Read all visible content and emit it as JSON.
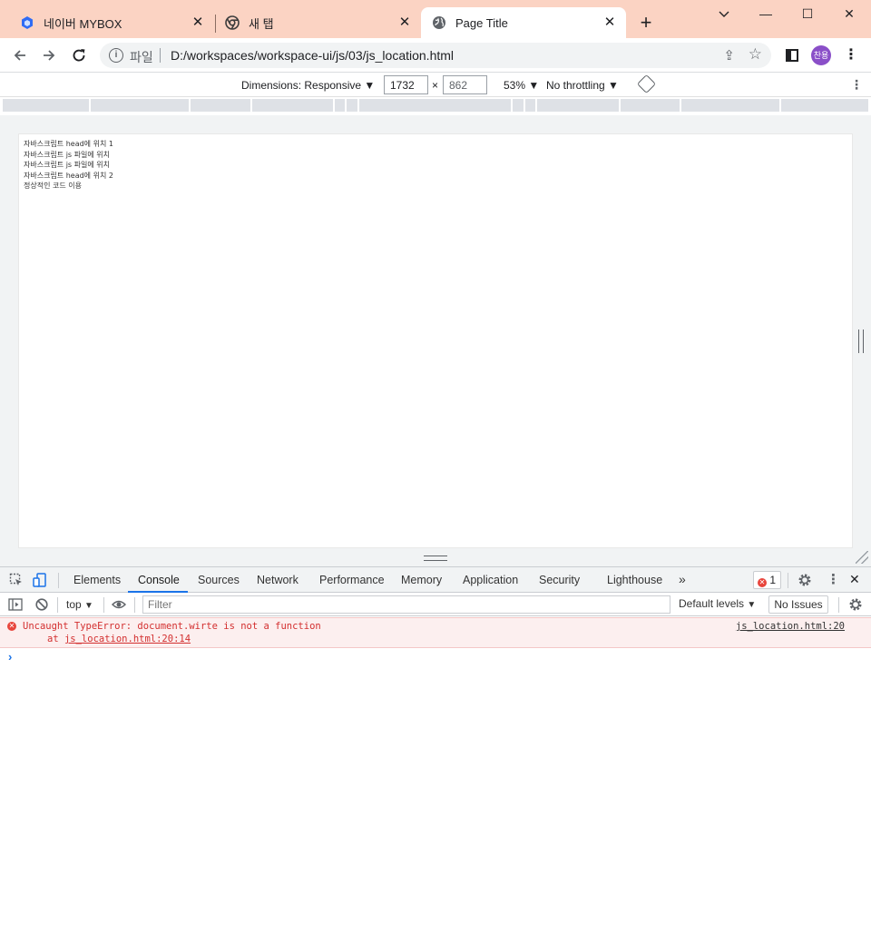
{
  "browser": {
    "tabs": [
      {
        "title": "네이버 MYBOX",
        "icon": "mybox-icon"
      },
      {
        "title": "새 탭",
        "icon": "chrome-icon"
      },
      {
        "title": "Page Title",
        "icon": "globe-icon",
        "active": true
      }
    ],
    "window_controls": {
      "minimize": "—",
      "maximize": "☐",
      "close": "✕"
    },
    "address": {
      "scheme_label": "파일",
      "url": "D:/workspaces/workspace-ui/js/03/js_location.html"
    },
    "profile_label": "찬용"
  },
  "device_toolbar": {
    "dimensions_label": "Dimensions: Responsive",
    "width": "1732",
    "height": "862",
    "times": "×",
    "zoom": "53%",
    "throttling": "No throttling"
  },
  "page_content": {
    "lines": [
      "자바스크립트 head에 위치 1",
      "자바스크립트 js 파일에 위치",
      "자바스크립트 js 파일에 위치",
      "자바스크립트 head에 위치 2",
      "정상적인 코드 이용"
    ]
  },
  "devtools": {
    "tabs": [
      "Elements",
      "Console",
      "Sources",
      "Network",
      "Performance",
      "Memory",
      "Application",
      "Security",
      "Lighthouse"
    ],
    "active_tab": "Console",
    "more": "»",
    "error_count": "1",
    "console_toolbar": {
      "context": "top",
      "filter_placeholder": "Filter",
      "levels": "Default levels",
      "issues": "No Issues"
    },
    "messages": [
      {
        "level": "error",
        "text": "Uncaught TypeError: document.wirte is not a function",
        "stack_prefix": "at ",
        "stack_link": "js_location.html:20:14",
        "source": "js_location.html:20"
      }
    ],
    "prompt": "›"
  },
  "colors": {
    "tabstrip_bg": "#fbd3c3",
    "accent": "#1a73e8",
    "error_red": "#d32f2f",
    "error_bg": "#fcefef",
    "avatar": "#8a4fc8"
  }
}
